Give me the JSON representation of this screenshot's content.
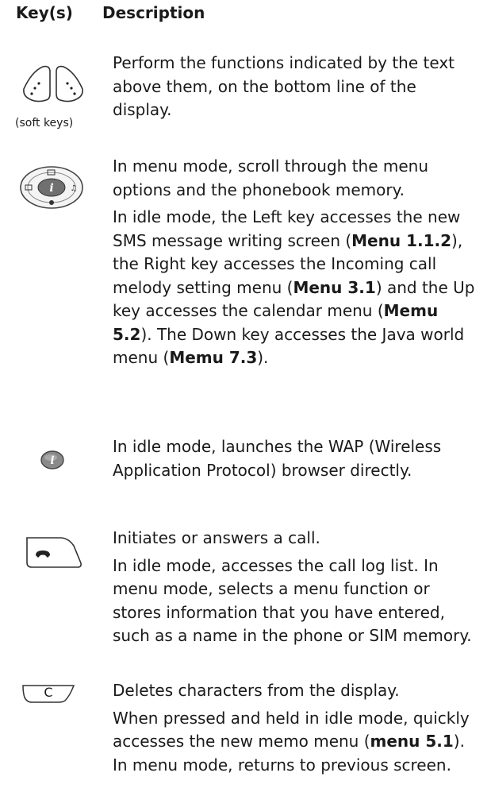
{
  "header": {
    "key_label": "Key(s)",
    "description_label": "Description"
  },
  "rows": [
    {
      "icon": "soft-keys-icon",
      "caption": "(soft keys)",
      "paragraphs": [
        "Perform the functions indicated by the text above them, on the bottom line of the display."
      ]
    },
    {
      "icon": "navigation-keys-icon",
      "p1": "In menu mode, scroll through the menu options and the phonebook memory.",
      "p2": {
        "t1": "In idle mode, the Left key accesses the new SMS message writing screen (",
        "b1": "Menu 1.1.2",
        "t2": "), the Right key accesses the Incoming call melody setting menu (",
        "b2": "Menu 3.1",
        "t3": ") and the Up key accesses the calendar menu (",
        "b3": "Memu 5.2",
        "t4": "). The Down key accesses the Java world menu (",
        "b4": "Memu 7.3",
        "t5": ")."
      }
    },
    {
      "icon": "wap-key-icon",
      "p1": "In idle mode, launches the WAP (Wireless Application Protocol) browser directly."
    },
    {
      "icon": "send-key-icon",
      "p1": "Initiates or answers a call.",
      "p2": "In idle mode, accesses the call log list. In menu mode, selects a menu function or stores information that you have entered, such as a name in the phone or SIM memory."
    },
    {
      "icon": "clear-key-icon",
      "key_letter": "C",
      "p1": "Deletes characters from the display.",
      "p2": {
        "t1": "When pressed and held in idle mode, quickly accesses the new memo menu (",
        "b1": "menu 5.1",
        "t2": "). In menu mode, returns to previous screen."
      }
    }
  ]
}
